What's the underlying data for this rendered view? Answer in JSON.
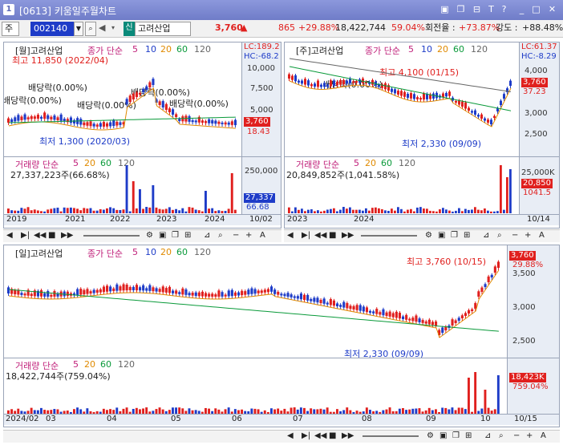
{
  "window": {
    "badge": "1",
    "title": "[0613] 키움일주월차트",
    "buttons": [
      "▣",
      "❐",
      "⊟",
      "T",
      "?",
      "_",
      "□",
      "✕"
    ]
  },
  "toolbar": {
    "market": "주",
    "code": "002140",
    "credit_badge": "신",
    "stock_name": "고려산업",
    "price": "3,760",
    "change": "865",
    "change_pct": "+29.88%",
    "volume": "18,422,744",
    "vol_ratio": "59.04%",
    "turnover_label": "회전율 :",
    "turnover": "+73.87%",
    "strength_label": "강도 :",
    "strength": "+88.48%"
  },
  "monthly": {
    "title": "[월]고려산업",
    "ma_label": "종가 단순",
    "ma": [
      "5",
      "10",
      "20",
      "60",
      "120"
    ],
    "high_label": "최고 11,850 (2022/04)",
    "low_label": "최저 1,300 (2020/03)",
    "dividends": [
      "배당락(0.00%)",
      "배당락(0.00%)",
      "배당락(0.00%)",
      "배당락(0.00%)",
      "배당락(0.00%)",
      "배당락(0.00%)"
    ],
    "lc": "LC:189.2",
    "hc": "HC:-68.2",
    "y_ticks": [
      "10,000",
      "7,500",
      "5,000"
    ],
    "price_box": "3,760",
    "pct_box": "18.43",
    "vol_title": "거래량 단순",
    "vol_ma": [
      "5",
      "20",
      "60",
      "120"
    ],
    "vol_value": "27,337,223주(66.68%)",
    "vol_ticks": [
      "250,000"
    ],
    "vol_box": "27,337",
    "vol_pct": "66.68",
    "x_ticks": [
      "2019",
      "2021",
      "2022",
      "2023",
      "2024"
    ],
    "date": "10/02"
  },
  "weekly": {
    "title": "[주]고려산업",
    "ma_label": "종가 단순",
    "ma": [
      "5",
      "10",
      "20",
      "60",
      "120"
    ],
    "high_label": "최고 4,100 (01/15)",
    "low_label": "최저 2,330 (09/09)",
    "dividend": "배당락(0.00%)",
    "lc": "LC:61.37",
    "hc": "HC:-8.29",
    "y_ticks": [
      "4,000",
      "3,500",
      "3,000",
      "2,500"
    ],
    "price_box": "3,760",
    "pct_box": "37.23",
    "vol_title": "거래량 단순",
    "vol_ma": [
      "5",
      "20",
      "60",
      "120"
    ],
    "vol_value": "20,849,852주(1,041.58%)",
    "vol_ticks": [
      "25,000K"
    ],
    "vol_box": "20,850",
    "vol_pct": "1041.5",
    "x_ticks": [
      "2023",
      "2024"
    ],
    "date": "10/14"
  },
  "daily": {
    "title": "[일]고려산업",
    "ma_label": "종가 단순",
    "ma": [
      "5",
      "10",
      "20",
      "60",
      "120"
    ],
    "high_label": "최고 3,760 (10/15)",
    "low_label": "최저 2,330 (09/09)",
    "y_ticks": [
      "3,500",
      "3,000",
      "2,500"
    ],
    "price_box": "3,760",
    "pct_box": "29.88%",
    "vol_title": "거래량 단순",
    "vol_ma": [
      "5",
      "20",
      "60",
      "120"
    ],
    "vol_value": "18,422,744주(759.04%)",
    "vol_box": "18,423K",
    "vol_pct": "759.04%",
    "x_ticks": [
      "2024/02",
      "03",
      "04",
      "05",
      "06",
      "07",
      "08",
      "09",
      "10"
    ],
    "date": "10/15"
  },
  "colors": {
    "up": "#e0201e",
    "down": "#1e3cc8",
    "ma5": "#d0202a",
    "ma10": "#1e3cc8",
    "ma20": "#e08a00",
    "ma60": "#0a9a3a",
    "ma120": "#666666"
  }
}
